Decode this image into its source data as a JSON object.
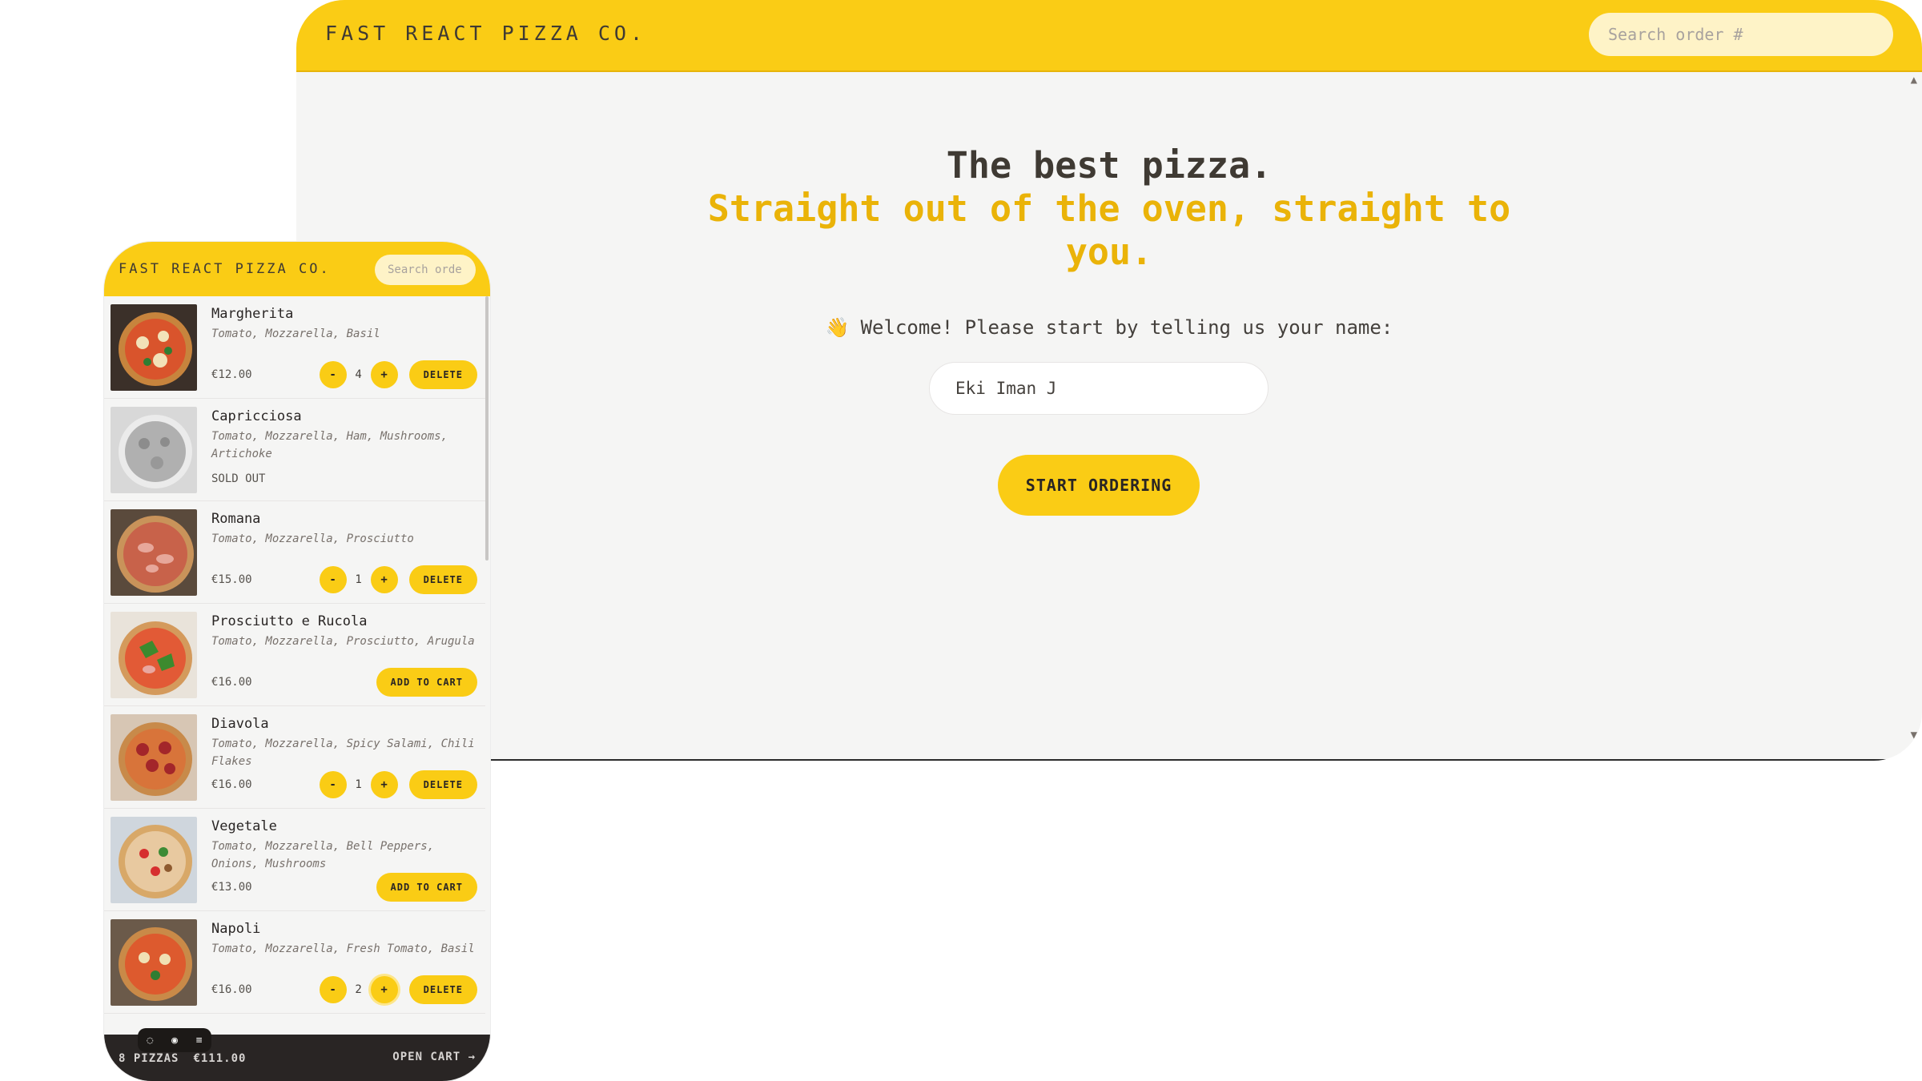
{
  "desktop": {
    "logo": "FAST REACT PIZZA CO.",
    "search_placeholder": "Search order #",
    "title_line1": "The best pizza.",
    "title_line2": "Straight out of the oven, straight to you.",
    "welcome_icon": "👋",
    "welcome_text": "Welcome! Please start by telling us your name:",
    "name_value": "Eki Iman J",
    "start_button": "START ORDERING"
  },
  "mobile": {
    "logo": "FAST REACT PIZZA CO.",
    "search_placeholder": "Search order #",
    "pizzas": [
      {
        "name": "Margherita",
        "ingredients": "Tomato, Mozzarella, Basil",
        "price": "€12.00",
        "quantity": "4",
        "action": "DELETE",
        "sold_out": false
      },
      {
        "name": "Capricciosa",
        "ingredients": "Tomato, Mozzarella, Ham, Mushrooms, Artichoke",
        "status": "SOLD OUT",
        "sold_out": true
      },
      {
        "name": "Romana",
        "ingredients": "Tomato, Mozzarella, Prosciutto",
        "price": "€15.00",
        "quantity": "1",
        "action": "DELETE",
        "sold_out": false
      },
      {
        "name": "Prosciutto e Rucola",
        "ingredients": "Tomato, Mozzarella, Prosciutto, Arugula",
        "price": "€16.00",
        "action": "ADD TO CART",
        "sold_out": false
      },
      {
        "name": "Diavola",
        "ingredients": "Tomato, Mozzarella, Spicy Salami, Chili Flakes",
        "price": "€16.00",
        "quantity": "1",
        "action": "DELETE",
        "sold_out": false
      },
      {
        "name": "Vegetale",
        "ingredients": "Tomato, Mozzarella, Bell Peppers, Onions, Mushrooms",
        "price": "€13.00",
        "action": "ADD TO CART",
        "sold_out": false
      },
      {
        "name": "Napoli",
        "ingredients": "Tomato, Mozzarella, Fresh Tomato, Basil",
        "price": "€16.00",
        "quantity": "2",
        "action": "DELETE",
        "sold_out": false
      }
    ],
    "decrease_label": "-",
    "increase_label": "+",
    "cart_count": "8 PIZZAS",
    "cart_total": "€111.00",
    "open_cart": "OPEN CART →",
    "toolbar_icons": [
      "chat-icon",
      "eye-icon",
      "list-icon"
    ]
  },
  "colors": {
    "accent": "#facc15",
    "accent_text": "#eab308",
    "background": "#f5f5f4",
    "footer": "#292524"
  }
}
